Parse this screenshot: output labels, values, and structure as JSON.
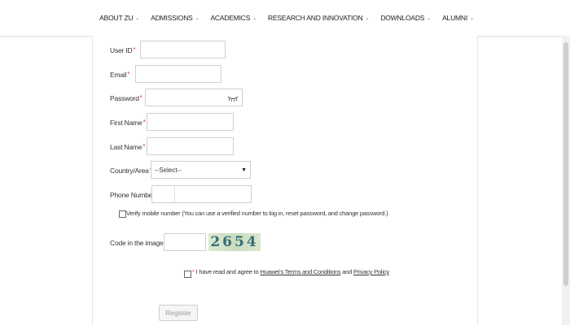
{
  "nav": {
    "items": [
      {
        "label": "ABOUT ZU"
      },
      {
        "label": "ADMISSIONS"
      },
      {
        "label": "ACADEMICS"
      },
      {
        "label": "RESEARCH AND INNOVATION"
      },
      {
        "label": "DOWNLOADS"
      },
      {
        "label": "ALUMNI"
      }
    ],
    "chevron": "⌄"
  },
  "form": {
    "required_mark": "*",
    "user_id_label": "User ID",
    "user_id_value": "",
    "email_label": "Email",
    "email_value": "",
    "password_label": "Password",
    "password_value": "",
    "first_name_label": "First Name",
    "first_name_value": "",
    "last_name_label": "Last Name",
    "last_name_value": "",
    "country_label": "Country/Area",
    "country_selected": "--Select--",
    "phone_label": "Phone Number",
    "phone_value": "",
    "verify_mobile_text": "Verify mobile number (You can use a verified number to log in, reset password, and change password.)",
    "captcha_label": "Code in the image",
    "captcha_value": "",
    "captcha_text": "2654",
    "agree_prefix": "I have read and agree to",
    "terms_link": "Huawei's Terms and Conditions",
    "agree_and": "and",
    "privacy_link": "Privacy Policy",
    "register_label": "Register"
  },
  "icons": {
    "password_toggle": "eye-closed-icon"
  }
}
